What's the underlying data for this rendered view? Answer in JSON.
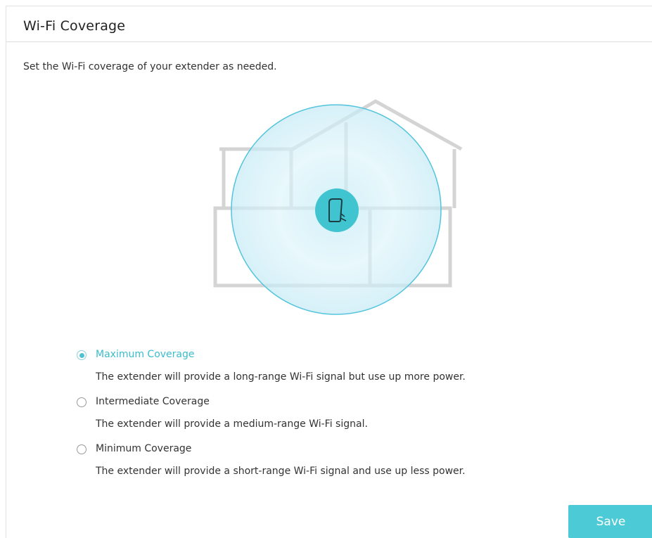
{
  "page": {
    "title": "Wi-Fi Coverage",
    "description": "Set the Wi-Fi coverage of your extender as needed."
  },
  "illustration": {
    "house_icon": "house-outline-icon",
    "coverage_icon": "coverage-circle-icon",
    "device_icon": "extender-device-icon"
  },
  "options": [
    {
      "label": "Maximum Coverage",
      "description": "The extender will provide a long-range Wi-Fi signal but use up more power.",
      "selected": true
    },
    {
      "label": "Intermediate Coverage",
      "description": "The extender will provide a medium-range Wi-Fi signal.",
      "selected": false
    },
    {
      "label": "Minimum Coverage",
      "description": "The extender will provide a short-range Wi-Fi signal and use up less power.",
      "selected": false
    }
  ],
  "actions": {
    "save_label": "Save"
  },
  "colors": {
    "accent": "#4ccad6",
    "selected_text": "#3bbccc",
    "house_outline": "#d4d4d4"
  }
}
